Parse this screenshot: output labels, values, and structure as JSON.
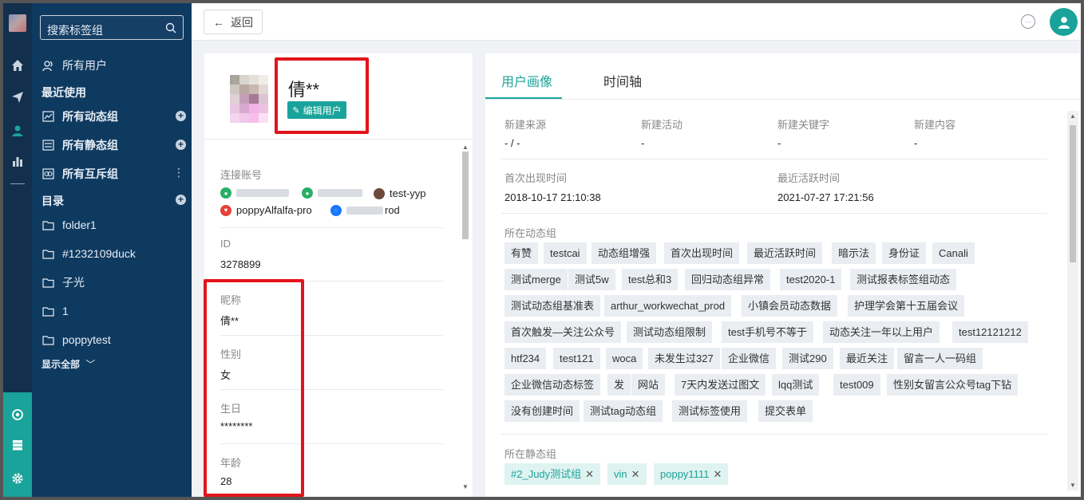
{
  "sidebar": {
    "search_placeholder": "搜索标签组",
    "all_users": "所有用户",
    "recent_heading": "最近使用",
    "recent": [
      {
        "label": "所有动态组"
      },
      {
        "label": "所有静态组"
      },
      {
        "label": "所有互斥组"
      }
    ],
    "catalog_heading": "目录",
    "folders": [
      {
        "label": "folder1"
      },
      {
        "label": "#1232109duck"
      },
      {
        "label": "子光"
      },
      {
        "label": "1"
      },
      {
        "label": "poppytest"
      }
    ],
    "show_all": "显示全部"
  },
  "topbar": {
    "back_label": "返回"
  },
  "profile": {
    "name": "倩**",
    "edit_label": "编辑用户",
    "accounts_label": "连接账号",
    "accounts": [
      {
        "icon": "wechat-icon",
        "text": ""
      },
      {
        "icon": "wechat-icon",
        "text": ""
      },
      {
        "icon": "avatar-icon",
        "text": "test-yyp"
      },
      {
        "icon": "weibo-icon",
        "text": "poppyAlfalfa-pro"
      },
      {
        "icon": "alipay-icon",
        "text": "rod"
      }
    ],
    "fields": [
      {
        "label": "ID",
        "value": "3278899"
      },
      {
        "label": "昵称",
        "value": "倩**"
      },
      {
        "label": "性别",
        "value": "女"
      },
      {
        "label": "生日",
        "value": "********"
      },
      {
        "label": "年龄",
        "value": "28"
      }
    ]
  },
  "tabs": [
    {
      "label": "用户画像"
    },
    {
      "label": "时间轴"
    }
  ],
  "stats": [
    {
      "label": "新建来源",
      "value": "- / -"
    },
    {
      "label": "新建活动",
      "value": "-"
    },
    {
      "label": "新建关键字",
      "value": "-"
    },
    {
      "label": "新建内容",
      "value": "-"
    }
  ],
  "times": [
    {
      "label": "首次出现时间",
      "value": "2018-10-17 21:10:38"
    },
    {
      "label": "最近活跃时间",
      "value": "2021-07-27 17:21:56"
    }
  ],
  "dynamic_groups_label": "所在动态组",
  "dynamic_groups": [
    [
      "有赞",
      "testcai",
      "动态组增强",
      "首次出现时间",
      "最近活跃时间",
      "暗示法",
      "身份证",
      "Canali"
    ],
    [
      "测试merge",
      "测试5w",
      "test总和3",
      "回归动态组异常",
      "test2020-1",
      "测试报表标签组动态"
    ],
    [
      "测试动态组基准表",
      "arthur_workwechat_prod",
      "小镇会员动态数据",
      "护理学会第十五届会议"
    ],
    [
      "首次触发—关注公众号",
      "测试动态组限制",
      "test手机号不等于",
      "动态关注一年以上用户",
      "test12121212"
    ],
    [
      "htf234",
      "test121",
      "woca",
      "未发生过327",
      "企业微信",
      "测试290",
      "最近关注",
      "留言一人一码组"
    ],
    [
      "企业微信动态标签",
      "发",
      "网站",
      "7天内发送过图文",
      "lqq测试",
      "test009",
      "性别女留言公众号tag下钻"
    ],
    [
      "没有创建时间",
      "测试tag动态组",
      "测试标签使用",
      "提交表单"
    ]
  ],
  "static_groups_label": "所在静态组",
  "static_groups": [
    "#2_Judy测试组",
    "vin",
    "poppy1111"
  ],
  "colors": {
    "accent": "#1aa39a",
    "sidebar": "#0f3a60",
    "rail": "#12304e",
    "highlight": "#e3141b"
  }
}
